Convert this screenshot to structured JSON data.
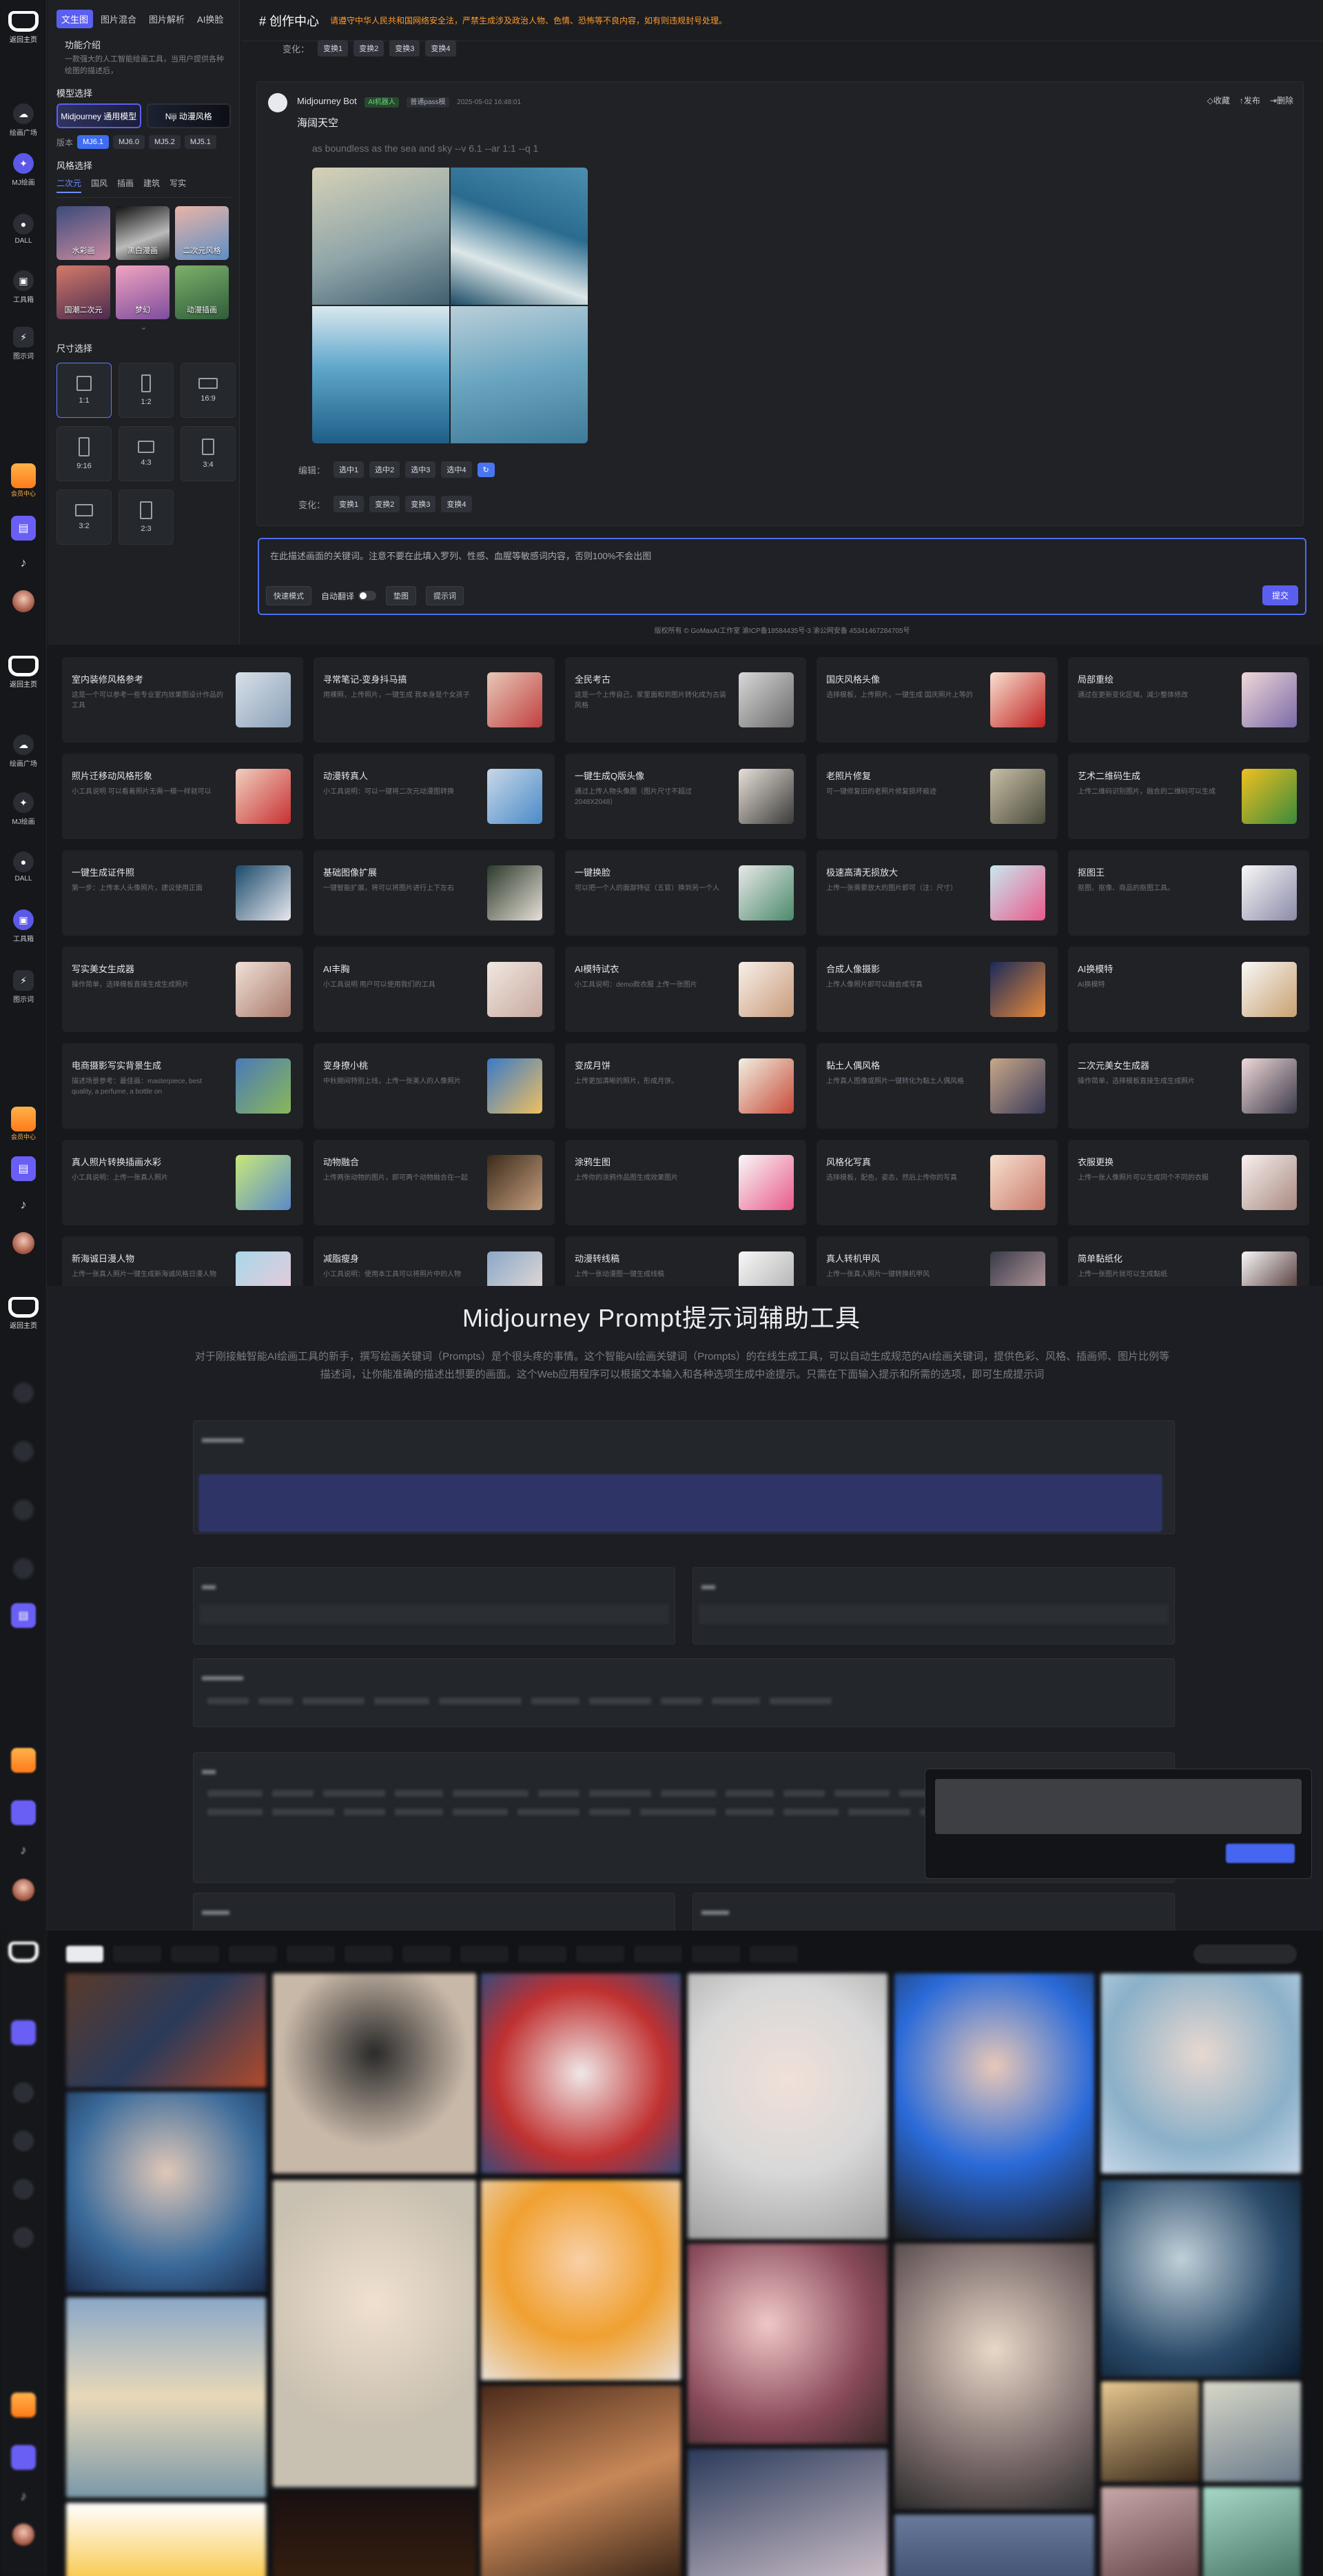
{
  "rail": {
    "logo_label": "返回主页",
    "items": [
      {
        "label": "绘画广场"
      },
      {
        "label": "MJ绘画"
      },
      {
        "label": "DALL"
      },
      {
        "label": "工具箱"
      },
      {
        "label": "图示词"
      }
    ],
    "vip_label": "会员中心"
  },
  "mj": {
    "tabs": [
      "文生图",
      "图片混合",
      "图片解析",
      "AI换脸"
    ],
    "func_title": "功能介绍",
    "func_desc": "一款强大的人工智能绘画工具，当用户提供各种绘图的描述后，",
    "model_title": "模型选择",
    "models": [
      "Midjourney 通用模型",
      "Niji 动漫风格"
    ],
    "version_label": "版本",
    "versions": [
      "MJ6.1",
      "MJ6.0",
      "MJ5.2",
      "MJ5.1"
    ],
    "style_title": "风格选择",
    "style_tabs": [
      "二次元",
      "国风",
      "插画",
      "建筑",
      "写实"
    ],
    "styles": [
      "水彩画",
      "黑白漫画",
      "二次元风格",
      "国潮二次元",
      "梦幻",
      "动漫插画"
    ],
    "size_title": "尺寸选择",
    "sizes": [
      "1:1",
      "1:2",
      "16:9",
      "9:16",
      "4:3",
      "3:4",
      "3:2",
      "2:3"
    ],
    "topbar_title": "# 创作中心",
    "warning": "请遵守中华人民共和国网络安全法，严禁生成涉及政治人物、色情、恐怖等不良内容，如有则违规封号处理。",
    "variation_label": "变化：",
    "edit_label": "编辑：",
    "pick_buttons": [
      "选中1",
      "选中2",
      "选中3",
      "选中4"
    ],
    "var_buttons": [
      "变换1",
      "变换2",
      "变换3",
      "变换4"
    ],
    "bot_name": "Midjourney Bot",
    "bot_badge": "AI机器人",
    "model_badge": "普通pass模",
    "timestamp": "2025-05-02 16:48:01",
    "msg_actions": [
      "◇收藏",
      "↑发布",
      "⇥删除"
    ],
    "msg_title": "海阔天空",
    "msg_prompt": "as boundless as the sea and sky --v 6.1 --ar 1:1 --q 1",
    "input_placeholder": "在此描述画面的关键词。注意不要在此填入罗列、性感、血腥等敏感词内容，否则100%不会出图",
    "tool_quick": "快速模式",
    "tool_translate": "自动翻译",
    "tool_ref": "垫图",
    "tool_prompt": "提示词",
    "send_label": "提交",
    "footer": "版权所有 © GoMaxAI工作室   渝ICP备18584435号-3   渝公网安备 45341467284705号"
  },
  "tools": [
    {
      "title": "室内装修风格参考",
      "desc": "这是一个可以参考一些专业室内效果图设计作品的工具"
    },
    {
      "title": "寻常笔记-变身抖马搞",
      "desc": "用裸照，上传照片，一键生成 我本身是个女孩子"
    },
    {
      "title": "全民考古",
      "desc": "这是一个上传自己，家里面和到图片转化成为古装风格"
    },
    {
      "title": "国庆风格头像",
      "desc": "选择模板，上传照片，一键生成 国庆照片上等的"
    },
    {
      "title": "局部重绘",
      "desc": "通过在更新变化区域，减少整体修改"
    },
    {
      "title": "照片迁移动风格形象",
      "desc": "小工具说明 可以看着照片无需一模一样就可以"
    },
    {
      "title": "动漫转真人",
      "desc": "小工具说明：可以一键将二次元动漫图转换"
    },
    {
      "title": "一键生成Q版头像",
      "desc": "通过上传人物头像图（图片尺寸不超过2048X2048）"
    },
    {
      "title": "老照片修复",
      "desc": "可一键修复旧的老照片修复损坏痕迹"
    },
    {
      "title": "艺术二维码生成",
      "desc": "上传二维码识别图片，融合的二维码可以生成"
    },
    {
      "title": "一键生成证件照",
      "desc": "第一步：上传本人头像照片，建议使用正面"
    },
    {
      "title": "基础图像扩展",
      "desc": "一键智能扩展，将可以将图片进行上下左右"
    },
    {
      "title": "一键换脸",
      "desc": "可以把一个人的面部特征（五官）换到另一个人"
    },
    {
      "title": "极速高清无损放大",
      "desc": "上传一张需要放大的图片即可（注：尺寸）"
    },
    {
      "title": "抠图王",
      "desc": "抠图、抠像、商品的抠图工具。"
    },
    {
      "title": "写实美女生成器",
      "desc": "操作简单，选择模板直接生成生成照片"
    },
    {
      "title": "AI丰胸",
      "desc": "小工具说明 用户可以使用我们的工具"
    },
    {
      "title": "AI模特试衣",
      "desc": "小工具说明：demo款衣服 上传一张图片"
    },
    {
      "title": "合成人像摄影",
      "desc": "上传人像照片即可以融合成写真"
    },
    {
      "title": "AI换模特",
      "desc": "AI换模特"
    },
    {
      "title": "电商摄影写实背景生成",
      "desc": "描述场景参考：最佳画：masterpiece, best quality, a perfume, a bottle on"
    },
    {
      "title": "变身撩小桃",
      "desc": "中秋期间特别上线，上传一张美人的人像照片"
    },
    {
      "title": "变成月饼",
      "desc": "上传更加清晰的照片，形成月饼。"
    },
    {
      "title": "黏土人偶风格",
      "desc": "上传真人图像或照片一键转化为黏土人偶风格"
    },
    {
      "title": "二次元美女生成器",
      "desc": "操作简单，选择模板直接生成生成照片"
    },
    {
      "title": "真人照片转换插画水彩",
      "desc": "小工具说明：上传一张真人照片"
    },
    {
      "title": "动物融合",
      "desc": "上传两张动物的图片，即可两个动物融合在一起"
    },
    {
      "title": "涂鸦生图",
      "desc": "上传你的涂鸦作品图生成效果图片"
    },
    {
      "title": "风格化写真",
      "desc": "选择模板，配色，姿态，然后上传你的写真"
    },
    {
      "title": "衣服更换",
      "desc": "上传一张人像照片可以生成同个不同的衣服"
    },
    {
      "title": "新海诚日漫人物",
      "desc": "上传一张真人照片一键生成新海诚风格日漫人物"
    },
    {
      "title": "减脂瘦身",
      "desc": "小工具说明：使用本工具可以将照片中的人物"
    },
    {
      "title": "动漫转线稿",
      "desc": "上传一张动漫图一键生成线稿"
    },
    {
      "title": "真人转机甲风",
      "desc": "上传一张真人照片一键转换机甲风"
    },
    {
      "title": "简单黏纸化",
      "desc": "上传一张图片就可以生成黏纸"
    }
  ],
  "prompt_tool": {
    "title": "Midjourney Prompt提示词辅助工具",
    "desc": "对于刚接触智能AI绘画工具的新手，撰写绘画关键词（Prompts）是个很头疼的事情。这个智能AI绘画关键词（Prompts）的在线生成工具，可以自动生成规范的AI绘画关键词，提供色彩、风格、插画师、图片比例等描述词，让你能准确的描述出想要的画面。这个Web应用程序可以根据文本输入和各种选项生成中途提示。只需在下面输入提示和所需的选项，即可生成提示词"
  },
  "colors": {
    "accent": "#5b5ff0",
    "warning": "#ff9a2a",
    "panel": "#202226"
  }
}
